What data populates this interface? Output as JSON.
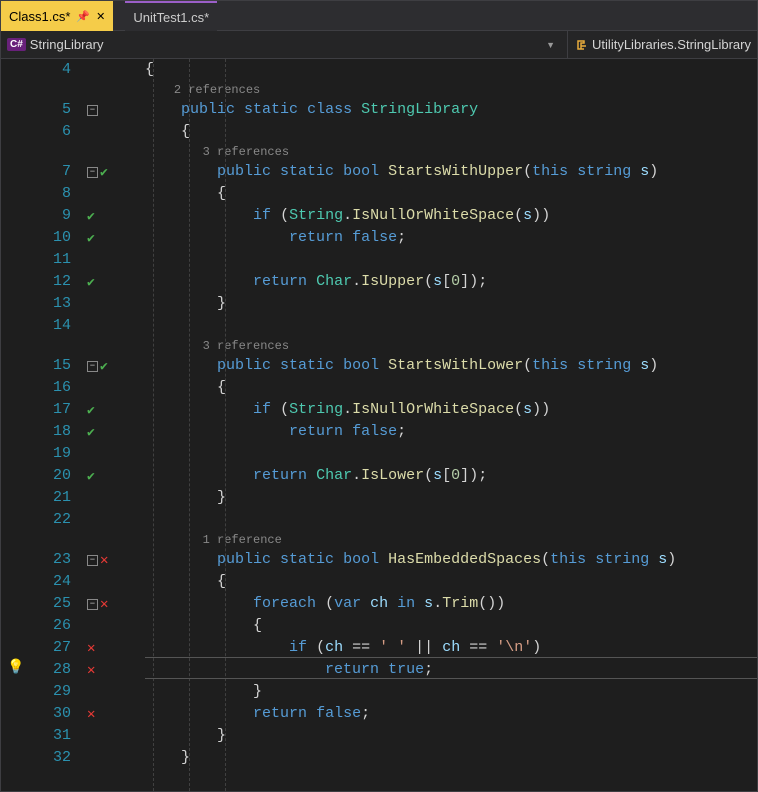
{
  "tabs": [
    {
      "label": "Class1.cs*",
      "active": true
    },
    {
      "label": "UnitTest1.cs*",
      "active": false
    }
  ],
  "breadcrumb": {
    "left": "StringLibrary",
    "right": "UtilityLibraries.StringLibrary"
  },
  "codelens": {
    "class": "2 references",
    "m1": "3 references",
    "m2": "3 references",
    "m3": "1 reference"
  },
  "lines": {
    "l4": "4",
    "l5": "5",
    "l6": "6",
    "l7": "7",
    "l8": "8",
    "l9": "9",
    "l10": "10",
    "l11": "11",
    "l12": "12",
    "l13": "13",
    "l14": "14",
    "l15": "15",
    "l16": "16",
    "l17": "17",
    "l18": "18",
    "l19": "19",
    "l20": "20",
    "l21": "21",
    "l22": "22",
    "l23": "23",
    "l24": "24",
    "l25": "25",
    "l26": "26",
    "l27": "27",
    "l28": "28",
    "l29": "29",
    "l30": "30",
    "l31": "31",
    "l32": "32"
  },
  "tokens": {
    "public": "public",
    "static": "static",
    "class": "class",
    "bool": "bool",
    "this": "this",
    "string": "string",
    "if": "if",
    "return": "return",
    "false": "false",
    "true": "true",
    "foreach": "foreach",
    "var": "var",
    "in": "in",
    "StringLibrary": "StringLibrary",
    "StartsWithUpper": "StartsWithUpper",
    "StartsWithLower": "StartsWithLower",
    "HasEmbeddedSpaces": "HasEmbeddedSpaces",
    "String": "String",
    "Char": "Char",
    "IsNullOrWhiteSpace": "IsNullOrWhiteSpace",
    "IsUpper": "IsUpper",
    "IsLower": "IsLower",
    "Trim": "Trim",
    "s": "s",
    "ch": "ch",
    "zero": "0",
    "space_char": "' '",
    "nl_char": "'\\n'",
    "obrace": "{",
    "cbrace": "}",
    "oparen": "(",
    "cparen": ")",
    "obrkt": "[",
    "cbrkt": "]",
    "semi": ";",
    "dot": ".",
    "comma": ",",
    "eqeq": "==",
    "oror": "||"
  }
}
